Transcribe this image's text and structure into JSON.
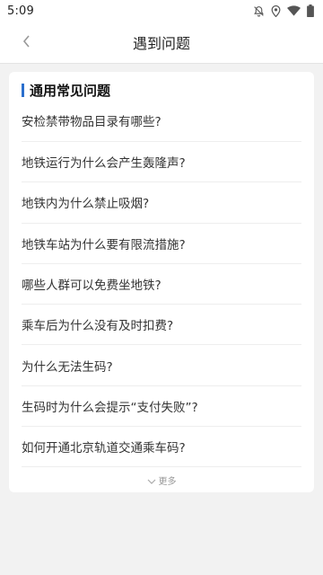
{
  "status_bar": {
    "time": "5:09",
    "icons": [
      "notifications-off-icon",
      "location-icon",
      "wifi-icon",
      "battery-icon"
    ]
  },
  "header": {
    "title": "遇到问题",
    "back_icon": "chevron-left-icon"
  },
  "faq": {
    "section_title": "通用常见问题",
    "accent_color": "#2b6fcd",
    "items": [
      "安检禁带物品目录有哪些?",
      "地铁运行为什么会产生轰隆声?",
      "地铁内为什么禁止吸烟?",
      "地铁车站为什么要有限流措施?",
      "哪些人群可以免费坐地铁?",
      "乘车后为什么没有及时扣费?",
      "为什么无法生码?",
      "生码时为什么会提示“支付失败”?",
      "如何开通北京轨道交通乘车码?"
    ],
    "more_label": "更多",
    "more_icon": "chevron-down-icon"
  }
}
